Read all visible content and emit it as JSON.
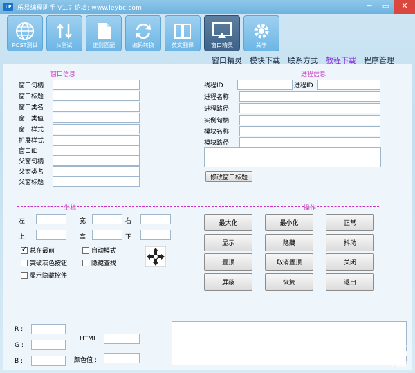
{
  "window": {
    "logo": "LE",
    "title": "乐易编程助手 V1.7 论坛: www.leybc.com",
    "min": "━",
    "max": "▭",
    "close": "✕"
  },
  "toolbar": [
    {
      "label": "POST测试",
      "icon": "globe-icon"
    },
    {
      "label": "Js测试",
      "icon": "arrows-icon"
    },
    {
      "label": "正则匹配",
      "icon": "document-icon"
    },
    {
      "label": "编码转换",
      "icon": "refresh-icon"
    },
    {
      "label": "英文翻译",
      "icon": "book-icon"
    },
    {
      "label": "窗口精灵",
      "icon": "monitor-icon",
      "active": true
    },
    {
      "label": "关于",
      "icon": "gear-icon"
    }
  ],
  "nav": [
    "窗口精灵",
    "模块下载",
    "联系方式",
    "教程下载",
    "程序管理"
  ],
  "window_info": {
    "title": "窗口信息",
    "fields": [
      "窗口句柄",
      "窗口标题",
      "窗口类名",
      "窗口类值",
      "窗口样式",
      "扩展样式",
      "窗口ID",
      "父窗句柄",
      "父窗类名",
      "父窗标题"
    ]
  },
  "process_info": {
    "title": "进程信息",
    "thread_id": "线程ID",
    "process_id": "进程ID",
    "fields": [
      "进程名称",
      "进程路径",
      "实例句柄",
      "模块名称",
      "模块路径"
    ],
    "modify_button": "修改窗口标题"
  },
  "coords": {
    "title": "坐标",
    "left": "左",
    "width": "宽",
    "right": "右",
    "top": "上",
    "height": "高",
    "bottom": "下"
  },
  "checks": [
    {
      "label": "总在最前",
      "checked": true
    },
    {
      "label": "自动模式",
      "checked": false
    },
    {
      "label": "突破灰色按钮",
      "checked": false
    },
    {
      "label": "隐藏查找",
      "checked": false
    },
    {
      "label": "显示隐藏控件",
      "checked": false
    }
  ],
  "operations": {
    "title": "操作",
    "buttons": [
      "最大化",
      "最小化",
      "正常",
      "显示",
      "隐藏",
      "抖动",
      "置顶",
      "取消置顶",
      "关闭",
      "屏蔽",
      "恢复",
      "退出"
    ]
  },
  "color": {
    "r": "R :",
    "g": "G :",
    "b": "B :",
    "html": "HTML :",
    "color_value": "颜色值 :"
  },
  "watermark": {
    "text": "pc6",
    "sub": "下载站"
  }
}
